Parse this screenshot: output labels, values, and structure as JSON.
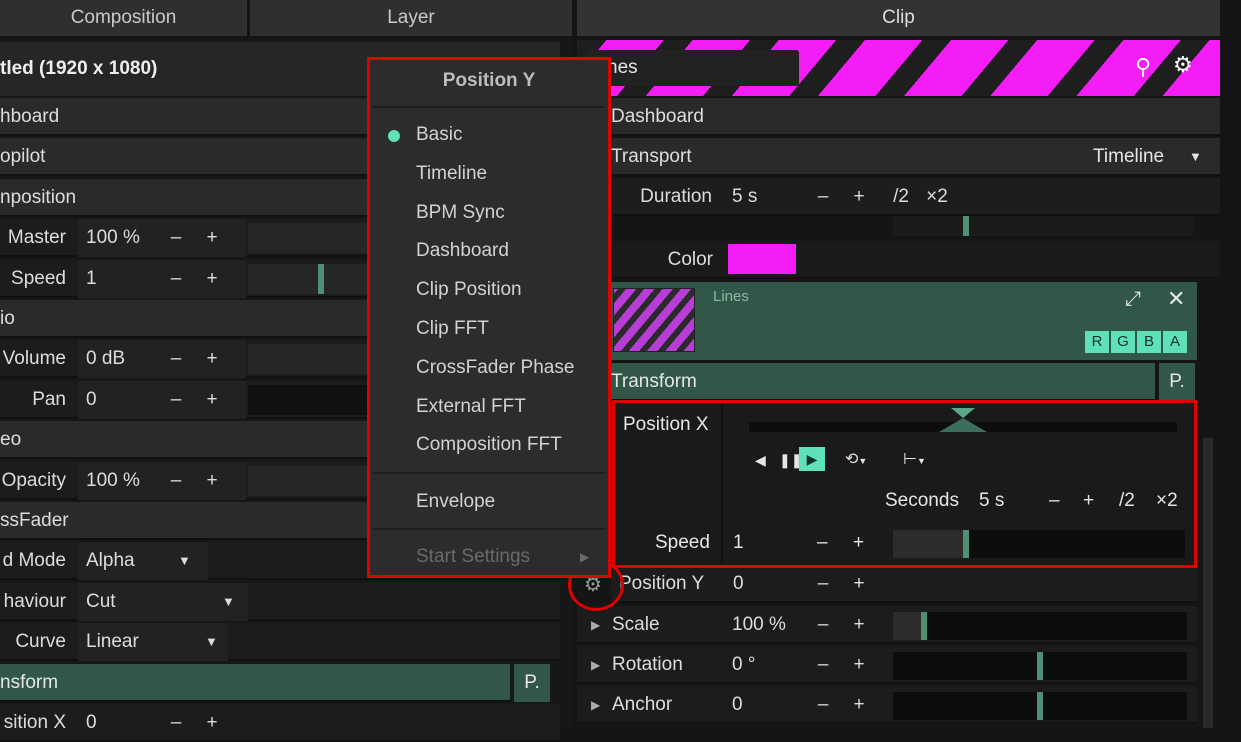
{
  "tabs": {
    "composition": "Composition",
    "layer": "Layer",
    "clip": "Clip"
  },
  "left": {
    "title": "tled (1920 x 1080)",
    "rows": [
      {
        "label": "hboard"
      },
      {
        "label": "opilot"
      },
      {
        "label": "nposition"
      },
      {
        "label": "Master",
        "value": "100 %"
      },
      {
        "label": "Speed",
        "value": "1"
      },
      {
        "label": "io"
      },
      {
        "label": "Volume",
        "value": "0 dB"
      },
      {
        "label": "Pan",
        "value": "0"
      },
      {
        "label": "eo"
      },
      {
        "label": "Opacity",
        "value": "100 %"
      },
      {
        "label": "ssFader"
      },
      {
        "label": "d Mode",
        "value": "Alpha"
      },
      {
        "label": "haviour",
        "value": "Cut"
      },
      {
        "label": "Curve",
        "value": "Linear"
      },
      {
        "label": "nsform",
        "p": "P."
      },
      {
        "label": "sition X",
        "value": "0"
      }
    ],
    "minus": "–",
    "plus": "+"
  },
  "menu": {
    "title": "Position Y",
    "items": [
      "Basic",
      "Timeline",
      "BPM Sync",
      "Dashboard",
      "Clip Position",
      "Clip FFT",
      "CrossFader Phase",
      "External FFT",
      "Composition FFT"
    ],
    "envelope": "Envelope",
    "start_settings": "Start Settings",
    "selected": "Basic"
  },
  "clip": {
    "name": "nes",
    "dashboard": "Dashboard",
    "transport": "Transport",
    "transport_mode": "Timeline",
    "duration_label": "Duration",
    "duration_value": "5 s",
    "half": "/2",
    "double": "×2",
    "speed_label": "Speed",
    "speed_value": "1",
    "color_label": "Color",
    "source_name": "Lines",
    "rgba": [
      "R",
      "G",
      "B",
      "A"
    ],
    "transform": "Transform",
    "p": "P.",
    "posx_label": "Position X",
    "seconds_label": "Seconds",
    "seconds_value": "5 s",
    "posx_speed_label": "Speed",
    "posx_speed_value": "1",
    "posy_label": "Position Y",
    "posy_value": "0",
    "scale_label": "Scale",
    "scale_value": "100 %",
    "rotation_label": "Rotation",
    "rotation_value": "0 °",
    "anchor_label": "Anchor",
    "anchor_value": "0",
    "minus": "–",
    "plus": "+"
  },
  "colors": {
    "accent": "#5fe0b8",
    "magenta": "#f41cf7",
    "highlight": "#e10000",
    "green_row": "#305748"
  }
}
